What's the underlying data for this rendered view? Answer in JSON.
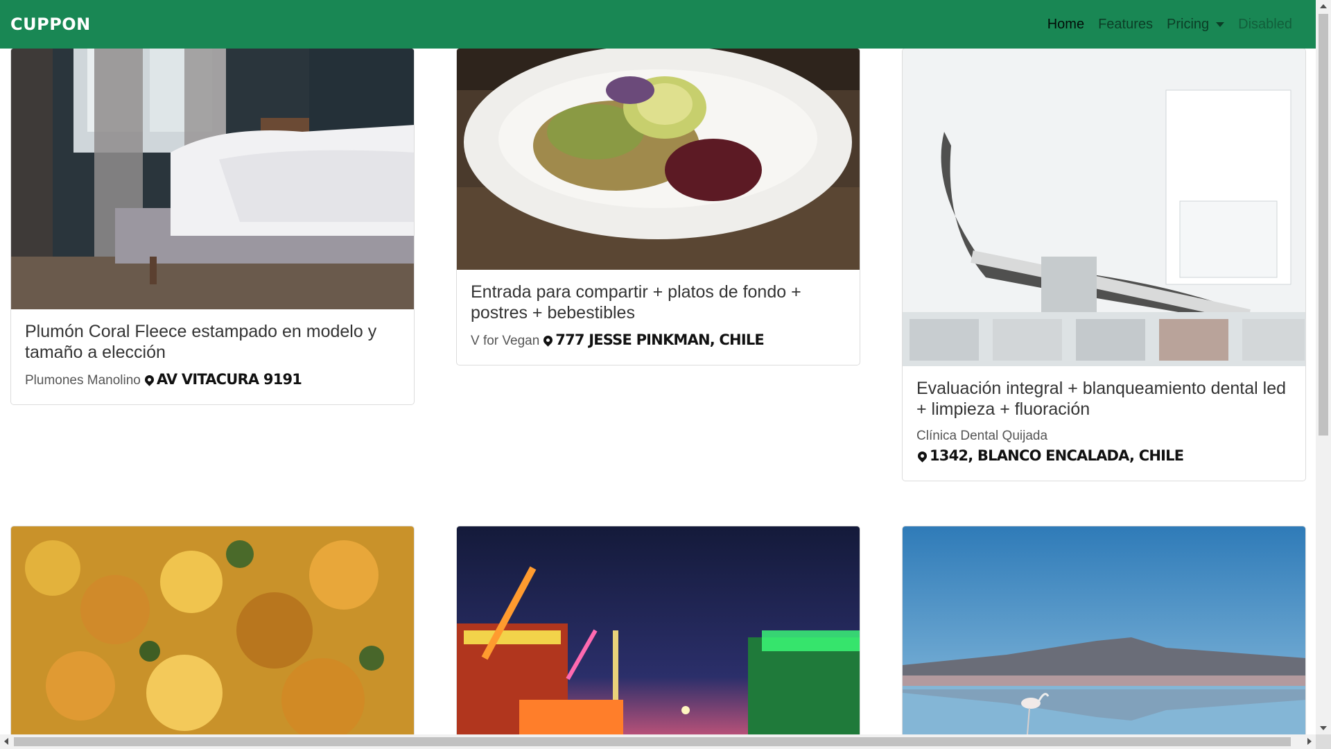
{
  "navbar": {
    "brand": "CUPPON",
    "links": [
      {
        "label": "Home",
        "state": "active"
      },
      {
        "label": "Features",
        "state": "normal"
      },
      {
        "label": "Pricing",
        "state": "dropdown"
      },
      {
        "label": "Disabled",
        "state": "disabled"
      }
    ],
    "color": "#198754"
  },
  "cards": [
    {
      "title": "Plumón Coral Fleece estampado en modelo y tamaño a elección",
      "store": "Plumones Manolino",
      "address": "AV VITACURA 9191",
      "image": "bedroom-bed-photo"
    },
    {
      "title": "Entrada para compartir + platos de fondo + postres + bebestibles",
      "store": "V for Vegan",
      "address": "777 JESSE PINKMAN, CHILE",
      "image": "vegan-food-plate-photo"
    },
    {
      "title": "Evaluación integral + blanqueamiento dental led + limpieza + fluoración",
      "store": "Clínica Dental Quijada",
      "address": "1342, BLANCO ENCALADA, CHILE",
      "image": "dental-chair-photo"
    },
    {
      "image": "stew-dish-photo"
    },
    {
      "image": "carnival-night-photo"
    },
    {
      "image": "flamingo-salt-flat-photo"
    }
  ]
}
